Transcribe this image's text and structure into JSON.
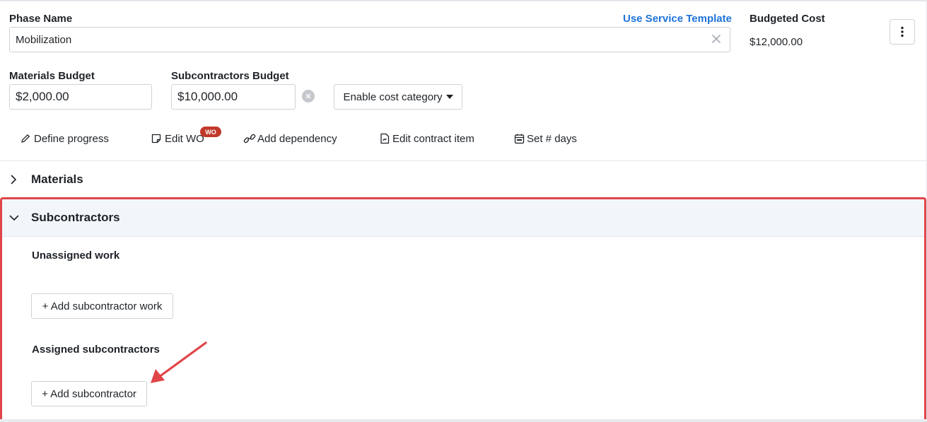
{
  "phase": {
    "name_label": "Phase Name",
    "name_value": "Mobilization",
    "use_template_label": "Use Service Template",
    "budgeted_cost_label": "Budgeted Cost",
    "budgeted_cost_value": "$12,000.00"
  },
  "budgets": {
    "materials_label": "Materials Budget",
    "materials_value": "$2,000.00",
    "subcontractors_label": "Subcontractors Budget",
    "subcontractors_value": "$10,000.00",
    "enable_cost_category_label": "Enable cost category"
  },
  "actions": {
    "define_progress": "Define progress",
    "edit_wo": "Edit WO",
    "wo_badge": "WO",
    "add_dependency": "Add dependency",
    "edit_contract_item": "Edit contract item",
    "set_days": "Set # days"
  },
  "sections": {
    "materials_title": "Materials",
    "subcontractors_title": "Subcontractors"
  },
  "subcontractors": {
    "unassigned_title": "Unassigned work",
    "add_work_button": "+ Add subcontractor work",
    "assigned_title": "Assigned subcontractors",
    "add_subcontractor_button": "+ Add subcontractor"
  },
  "colors": {
    "accent_link": "#1e73d8",
    "badge": "#c0392b",
    "highlight": "#e0454a",
    "section_bg": "#f2f6fb"
  }
}
